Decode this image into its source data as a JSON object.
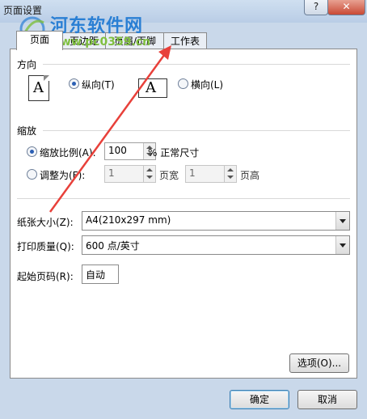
{
  "window": {
    "title": "页面设置",
    "help_label": "?",
    "close_label": "✕"
  },
  "watermark": {
    "site_name": "河东软件网",
    "site_url": "www.pc0359.cn"
  },
  "tabs": [
    {
      "label": "页面"
    },
    {
      "label": "页边距"
    },
    {
      "label": "页眉/页脚"
    },
    {
      "label": "工作表"
    }
  ],
  "orientation": {
    "section_label": "方向",
    "portrait_label": "纵向(T)",
    "landscape_label": "横向(L)",
    "selected": "portrait",
    "icon_glyph": "A"
  },
  "scaling": {
    "section_label": "缩放",
    "adjust_label": "缩放比例(A):",
    "adjust_value": "100",
    "adjust_suffix": "% 正常尺寸",
    "fit_label": "调整为(F):",
    "fit_wide_value": "1",
    "fit_wide_suffix": "页宽",
    "fit_tall_value": "1",
    "fit_tall_suffix": "页高"
  },
  "paper": {
    "size_label": "纸张大小(Z):",
    "size_value": "A4(210x297 mm)",
    "quality_label": "打印质量(Q):",
    "quality_value": "600 点/英寸",
    "first_page_label": "起始页码(R):",
    "first_page_value": "自动"
  },
  "buttons": {
    "options": "选项(O)...",
    "ok": "确定",
    "cancel": "取消"
  },
  "colors": {
    "arrow": "#e8403a",
    "accent": "#2b5fb4"
  }
}
